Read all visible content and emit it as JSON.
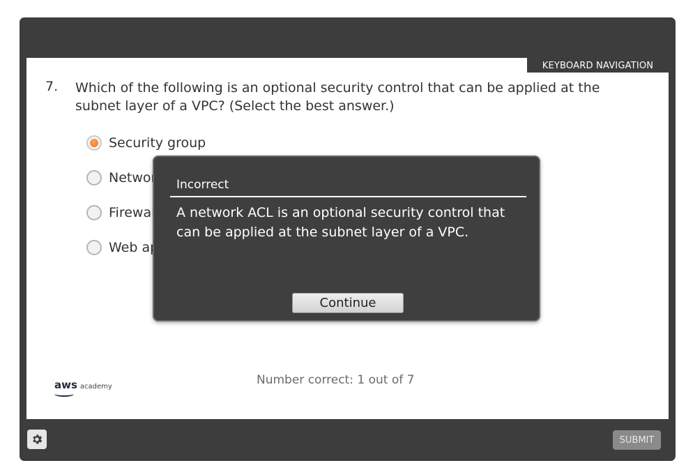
{
  "header": {
    "keyboard_nav_label": "KEYBOARD NAVIGATION"
  },
  "question": {
    "number": "7.",
    "text": "Which of the following is an optional security control that can be applied at the subnet layer of a VPC? (Select the best answer.)",
    "options": [
      {
        "label": "Security group",
        "selected": true
      },
      {
        "label": "Network ACL",
        "selected": false
      },
      {
        "label": "Firewall",
        "selected": false
      },
      {
        "label": "Web application firewall",
        "selected": false
      }
    ]
  },
  "logo": {
    "brand": "aws",
    "sub": "academy"
  },
  "score_text": "Number correct: 1 out of 7",
  "footer": {
    "settings_icon": "gear-icon",
    "submit_label": "SUBMIT"
  },
  "dialog": {
    "title": "Incorrect",
    "message": "A network ACL is an optional security control that can be applied at the subnet layer of a VPC.",
    "continue_label": "Continue"
  },
  "colors": {
    "frame": "#3d3d3d",
    "accent_radio": "#f0761f",
    "dialog_bg": "#3f3f3f"
  }
}
